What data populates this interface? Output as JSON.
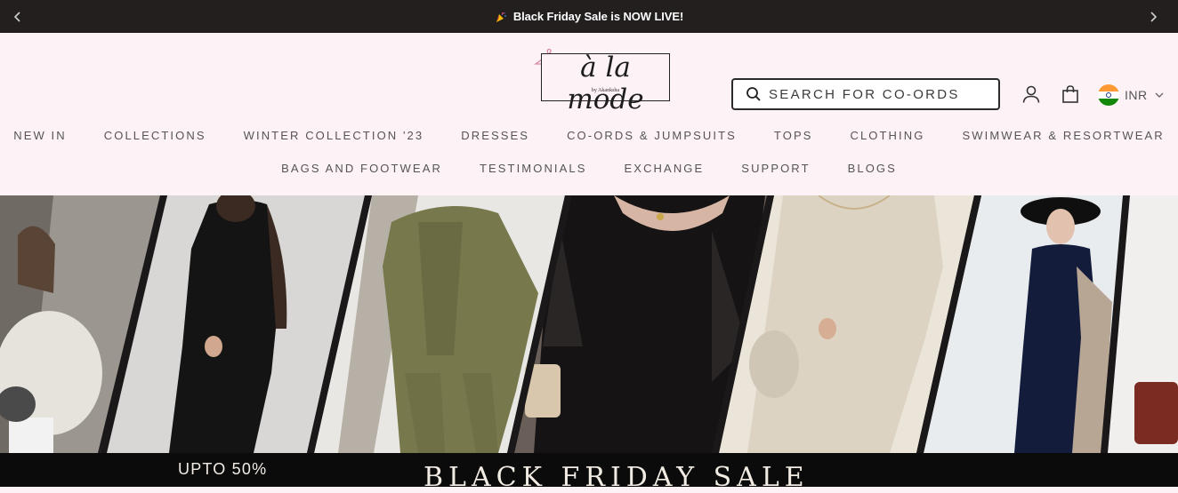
{
  "announcement": {
    "text": "Black Friday Sale is NOW LIVE!",
    "emoji_icon": "party-popper-icon"
  },
  "logo": {
    "text": "à la mode",
    "subtext": "by Akanksha"
  },
  "search": {
    "placeholder": "SEARCH FOR CO-ORDS"
  },
  "currency": {
    "code": "INR",
    "flag": "india-flag"
  },
  "nav": {
    "row1": [
      "NEW IN",
      "COLLECTIONS",
      "WINTER COLLECTION '23",
      "DRESSES",
      "CO-ORDS & JUMPSUITS",
      "TOPS",
      "CLOTHING",
      "SWIMWEAR & RESORTWEAR"
    ],
    "row2": [
      "BAGS AND FOOTWEAR",
      "TESTIMONIALS",
      "EXCHANGE",
      "SUPPORT",
      "BLOGS"
    ]
  },
  "banner": {
    "upto": "UPTO 50%",
    "title": "BLACK FRIDAY SALE"
  },
  "colors": {
    "announcement_bg": "#231f1f",
    "header_bg": "#fdf2f6",
    "banner_bg": "#0b0b0b"
  }
}
